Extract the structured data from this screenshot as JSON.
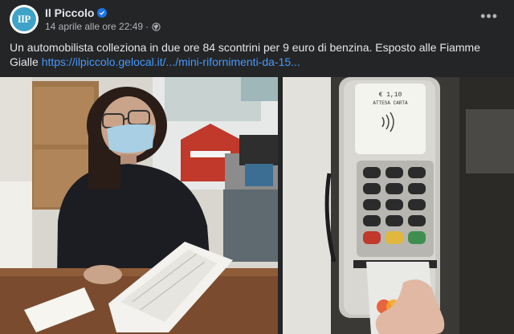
{
  "post": {
    "page_name": "Il Piccolo",
    "timestamp": "14 aprile alle ore 22:49",
    "separator": "·",
    "more_label": "•••",
    "avatar_text": "IlP",
    "text": "Un automobilista colleziona in due ore 84 scontrini per 9 euro di benzina. Esposto alle Fiamme Gialle ",
    "link_text": "https://ilpiccolo.gelocal.it/.../mini-rifornimenti-da-15...",
    "icons": {
      "verified": "verified-badge-icon",
      "audience": "globe-icon",
      "more": "more-options-icon"
    },
    "colors": {
      "background": "#242526",
      "link": "#4599ff",
      "verified": "#1b74e4"
    }
  },
  "terminal_screen": {
    "line1": "€ 1,10",
    "line2": "ATTESA CARTA"
  }
}
